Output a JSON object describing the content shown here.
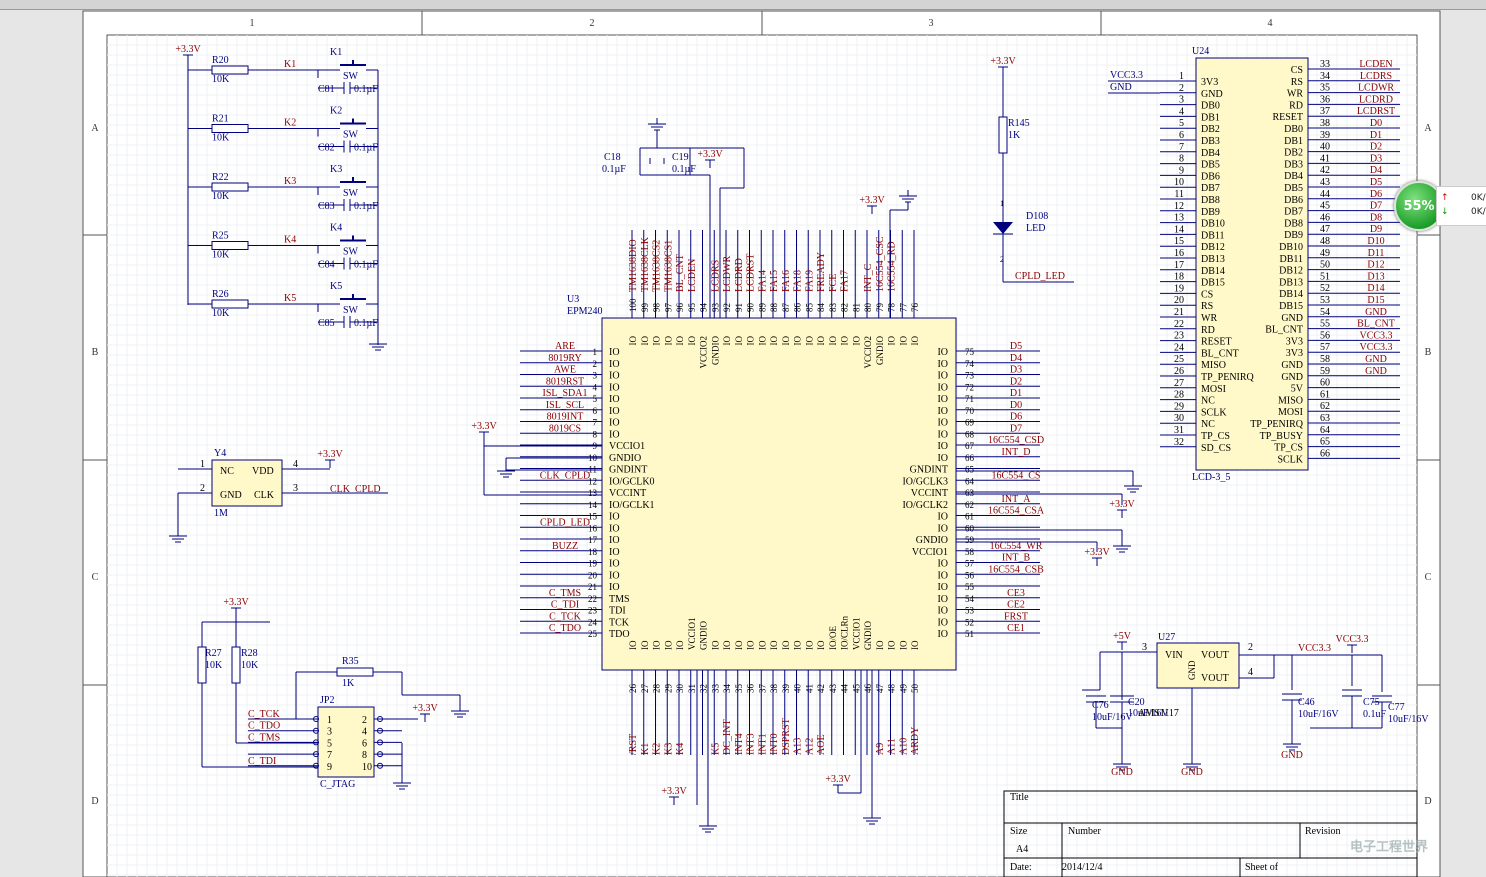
{
  "sheet": {
    "cols": [
      "1",
      "2",
      "3",
      "4"
    ],
    "rows": [
      "A",
      "B",
      "C",
      "D"
    ],
    "title_block": {
      "title_label": "Title",
      "size_label": "Size",
      "size_value": "A4",
      "number_label": "Number",
      "revision_label": "Revision",
      "date_label": "Date:",
      "date_value": "2014/12/4",
      "sheet_label": "Sheet    of"
    }
  },
  "power": {
    "v33": "+3.3V",
    "vcc33": "VCC3.3",
    "v5": "+5V",
    "gnd": "GND"
  },
  "keys": [
    {
      "r": "R20",
      "k": "K1",
      "sw": "K1",
      "c": "C81"
    },
    {
      "r": "R21",
      "k": "K2",
      "sw": "K2",
      "c": "C82"
    },
    {
      "r": "R22",
      "k": "K3",
      "sw": "K3",
      "c": "C83"
    },
    {
      "r": "R25",
      "k": "K4",
      "sw": "K4",
      "c": "C84"
    },
    {
      "r": "R26",
      "k": "K5",
      "sw": "K5",
      "c": "C85"
    }
  ],
  "key_common": {
    "rval": "10K",
    "sw": "SW",
    "cval": "0.1µF"
  },
  "osc": {
    "ref": "Y4",
    "val": "1M",
    "p1": "NC",
    "p2": "GND",
    "p3": "CLK",
    "p4": "VDD",
    "n1": "1",
    "n2": "2",
    "n3": "3",
    "n4": "4",
    "net": "CLK_CPLD"
  },
  "caps_top": {
    "c18": "C18",
    "c19": "C19",
    "val": "0.1µF"
  },
  "led": {
    "r": "R145",
    "rval": "1K",
    "d": "D108",
    "dval": "LED",
    "net": "CPLD_LED",
    "p1": "1",
    "p2": "2"
  },
  "jtag": {
    "ref": "JP2",
    "val": "C_JTAG",
    "r27": "R27",
    "r28": "R28",
    "rval": "10K",
    "r35": "R35",
    "r35v": "1K",
    "left_nums": [
      "1",
      "3",
      "5",
      "7",
      "9"
    ],
    "right_nums": [
      "2",
      "4",
      "6",
      "8",
      "10"
    ],
    "nets": [
      "C_TCK",
      "C_TDO",
      "C_TMS",
      "",
      "C_TDI"
    ]
  },
  "cpld": {
    "ref": "U3",
    "val": "EPM240",
    "left": [
      {
        "n": "1",
        "p": "IO",
        "net": "ARE"
      },
      {
        "n": "2",
        "p": "IO",
        "net": "8019RY"
      },
      {
        "n": "3",
        "p": "IO",
        "net": "AWE"
      },
      {
        "n": "4",
        "p": "IO",
        "net": "8019RST"
      },
      {
        "n": "5",
        "p": "IO",
        "net": "ISL_SDA1"
      },
      {
        "n": "6",
        "p": "IO",
        "net": "ISL_SCL"
      },
      {
        "n": "7",
        "p": "IO",
        "net": "8019INT"
      },
      {
        "n": "8",
        "p": "IO",
        "net": "8019CS"
      },
      {
        "n": "9",
        "p": "VCCIO1",
        "net": ""
      },
      {
        "n": "10",
        "p": "GNDIO",
        "net": ""
      },
      {
        "n": "11",
        "p": "GNDINT",
        "net": ""
      },
      {
        "n": "12",
        "p": "IO/GCLK0",
        "net": "CLK_CPLD"
      },
      {
        "n": "13",
        "p": "VCCINT",
        "net": ""
      },
      {
        "n": "14",
        "p": "IO/GCLK1",
        "net": ""
      },
      {
        "n": "15",
        "p": "IO",
        "net": ""
      },
      {
        "n": "16",
        "p": "IO",
        "net": "CPLD_LED"
      },
      {
        "n": "17",
        "p": "IO",
        "net": ""
      },
      {
        "n": "18",
        "p": "IO",
        "net": "BUZZ"
      },
      {
        "n": "19",
        "p": "IO",
        "net": ""
      },
      {
        "n": "20",
        "p": "IO",
        "net": ""
      },
      {
        "n": "21",
        "p": "IO",
        "net": ""
      },
      {
        "n": "22",
        "p": "TMS",
        "net": "C_TMS"
      },
      {
        "n": "23",
        "p": "TDI",
        "net": "C_TDI"
      },
      {
        "n": "24",
        "p": "TCK",
        "net": "C_TCK"
      },
      {
        "n": "25",
        "p": "TDO",
        "net": "C_TDO"
      }
    ],
    "right": [
      {
        "n": "75",
        "p": "IO",
        "net": "D5"
      },
      {
        "n": "74",
        "p": "IO",
        "net": "D4"
      },
      {
        "n": "73",
        "p": "IO",
        "net": "D3"
      },
      {
        "n": "72",
        "p": "IO",
        "net": "D2"
      },
      {
        "n": "71",
        "p": "IO",
        "net": "D1"
      },
      {
        "n": "70",
        "p": "IO",
        "net": "D0"
      },
      {
        "n": "69",
        "p": "IO",
        "net": "D6"
      },
      {
        "n": "68",
        "p": "IO",
        "net": "D7"
      },
      {
        "n": "67",
        "p": "IO",
        "net": "16C554_CSD"
      },
      {
        "n": "66",
        "p": "IO",
        "net": "INT_D"
      },
      {
        "n": "65",
        "p": "GNDINT",
        "net": ""
      },
      {
        "n": "64",
        "p": "IO/GCLK3",
        "net": "16C554_CS"
      },
      {
        "n": "63",
        "p": "VCCINT",
        "net": ""
      },
      {
        "n": "62",
        "p": "IO/GCLK2",
        "net": "INT_A"
      },
      {
        "n": "61",
        "p": "IO",
        "net": "16C554_CSA"
      },
      {
        "n": "60",
        "p": "IO",
        "net": ""
      },
      {
        "n": "59",
        "p": "GNDIO",
        "net": ""
      },
      {
        "n": "58",
        "p": "VCCIO1",
        "net": "16C554_WR"
      },
      {
        "n": "57",
        "p": "IO",
        "net": "INT_B"
      },
      {
        "n": "56",
        "p": "IO",
        "net": "16C554_CSB"
      },
      {
        "n": "55",
        "p": "IO",
        "net": ""
      },
      {
        "n": "54",
        "p": "IO",
        "net": "CE3"
      },
      {
        "n": "53",
        "p": "IO",
        "net": "CE2"
      },
      {
        "n": "52",
        "p": "IO",
        "net": "FRST"
      },
      {
        "n": "51",
        "p": "IO",
        "net": "CE1"
      }
    ],
    "top": [
      {
        "n": "100",
        "p": "IO",
        "net": "TM1638DIO"
      },
      {
        "n": "99",
        "p": "IO",
        "net": "TM1638CLK"
      },
      {
        "n": "98",
        "p": "IO",
        "net": "TM1638CS2"
      },
      {
        "n": "97",
        "p": "IO",
        "net": "TM1638CS1"
      },
      {
        "n": "96",
        "p": "IO",
        "net": "BL_CNT"
      },
      {
        "n": "95",
        "p": "IO",
        "net": "LCDEN"
      },
      {
        "n": "94",
        "p": "VCCIO2",
        "net": ""
      },
      {
        "n": "93",
        "p": "GNDIO",
        "net": "LCDRS"
      },
      {
        "n": "92",
        "p": "IO",
        "net": "LCDWR"
      },
      {
        "n": "91",
        "p": "IO",
        "net": "LCDRD"
      },
      {
        "n": "90",
        "p": "IO",
        "net": "LCDRST"
      },
      {
        "n": "89",
        "p": "IO",
        "net": "FA14"
      },
      {
        "n": "88",
        "p": "IO",
        "net": "FA15"
      },
      {
        "n": "87",
        "p": "IO",
        "net": "FA16"
      },
      {
        "n": "86",
        "p": "IO",
        "net": "FA18"
      },
      {
        "n": "85",
        "p": "IO",
        "net": "FA19"
      },
      {
        "n": "84",
        "p": "IO",
        "net": "FREADY"
      },
      {
        "n": "83",
        "p": "IO",
        "net": "FCE"
      },
      {
        "n": "82",
        "p": "IO",
        "net": "FA17"
      },
      {
        "n": "81",
        "p": "IO",
        "net": ""
      },
      {
        "n": "80",
        "p": "VCCIO2",
        "net": "INT_C"
      },
      {
        "n": "79",
        "p": "GNDIO",
        "net": "16C554_CSC"
      },
      {
        "n": "78",
        "p": "IO",
        "net": "16C554_RD"
      },
      {
        "n": "77",
        "p": "IO",
        "net": ""
      },
      {
        "n": "76",
        "p": "IO",
        "net": ""
      }
    ],
    "bottom": [
      {
        "n": "26",
        "p": "IO",
        "net": "/RST"
      },
      {
        "n": "27",
        "p": "IO",
        "net": "K1"
      },
      {
        "n": "28",
        "p": "IO",
        "net": "K2"
      },
      {
        "n": "29",
        "p": "IO",
        "net": "K3"
      },
      {
        "n": "30",
        "p": "IO",
        "net": "K4"
      },
      {
        "n": "31",
        "p": "VCCIO1",
        "net": ""
      },
      {
        "n": "32",
        "p": "GNDIO",
        "net": ""
      },
      {
        "n": "33",
        "p": "IO",
        "net": "K5"
      },
      {
        "n": "34",
        "p": "IO",
        "net": "DC_INT"
      },
      {
        "n": "35",
        "p": "IO",
        "net": "INT4"
      },
      {
        "n": "36",
        "p": "IO",
        "net": "INT3"
      },
      {
        "n": "37",
        "p": "IO",
        "net": "INT1"
      },
      {
        "n": "38",
        "p": "IO",
        "net": "INT0"
      },
      {
        "n": "39",
        "p": "IO",
        "net": "DSPRST"
      },
      {
        "n": "40",
        "p": "IO",
        "net": "A13"
      },
      {
        "n": "41",
        "p": "IO",
        "net": "A12"
      },
      {
        "n": "42",
        "p": "IO",
        "net": "AOE"
      },
      {
        "n": "43",
        "p": "IO/OE",
        "net": ""
      },
      {
        "n": "44",
        "p": "IO/CLRn",
        "net": ""
      },
      {
        "n": "45",
        "p": "VCCIO1",
        "net": ""
      },
      {
        "n": "46",
        "p": "GNDIO",
        "net": ""
      },
      {
        "n": "47",
        "p": "IO",
        "net": "A9"
      },
      {
        "n": "48",
        "p": "IO",
        "net": "A11"
      },
      {
        "n": "49",
        "p": "IO",
        "net": "A10"
      },
      {
        "n": "50",
        "p": "IO",
        "net": "ARDY"
      }
    ]
  },
  "lcd": {
    "ref": "U24",
    "val": "LCD-3_5",
    "left_nets": [
      "VCC3.3",
      "GND"
    ],
    "left": [
      "3V3",
      "GND",
      "DB0",
      "DB1",
      "DB2",
      "DB3",
      "DB4",
      "DB5",
      "DB6",
      "DB7",
      "DB8",
      "DB9",
      "DB10",
      "DB11",
      "DB12",
      "DB13",
      "DB14",
      "DB15",
      "CS",
      "RS",
      "WR",
      "RD",
      "RESET",
      "BL_CNT",
      "MISO",
      "TP_PENIRQ",
      "MOSI",
      "NC",
      "SCLK",
      "NC",
      "TP_CS",
      "SD_CS"
    ],
    "right_nums": [
      "33",
      "34",
      "35",
      "36",
      "37",
      "38",
      "39",
      "40",
      "41",
      "42",
      "43",
      "44",
      "45",
      "46",
      "47",
      "48",
      "49",
      "50",
      "51",
      "52",
      "53",
      "54",
      "55",
      "56",
      "57",
      "58",
      "59",
      "60",
      "61",
      "62",
      "63",
      "64",
      "65",
      "66"
    ],
    "right": [
      "CS",
      "RS",
      "WR",
      "RD",
      "RESET",
      "DB0",
      "DB1",
      "DB2",
      "DB3",
      "DB4",
      "DB5",
      "DB6",
      "DB7",
      "DB8",
      "DB9",
      "DB10",
      "DB11",
      "DB12",
      "DB13",
      "DB14",
      "DB15",
      "GND",
      "BL_CNT",
      "3V3",
      "3V3",
      "GND",
      "GND",
      "5V",
      "MISO",
      "MOSI",
      "TP_PENIRQ",
      "TP_BUSY",
      "TP_CS",
      "SCLK"
    ],
    "right_nets": [
      "LCDEN",
      "LCDRS",
      "LCDWR",
      "LCDRD",
      "LCDRST",
      "D0",
      "D1",
      "D2",
      "D3",
      "D4",
      "D5",
      "D6",
      "D7",
      "D8",
      "D9",
      "D10",
      "D11",
      "D12",
      "D13",
      "D14",
      "D15",
      "GND",
      "BL_CNT",
      "VCC3.3",
      "VCC3.3",
      "GND",
      "GND",
      "",
      "",
      "",
      "",
      "",
      "",
      ""
    ]
  },
  "reg": {
    "ref": "U27",
    "val": "AMS1117",
    "vin": "VIN",
    "vout": "VOUT",
    "gnd": "GND",
    "p1": "1",
    "p2": "2",
    "p3": "3",
    "p4": "4",
    "c76": "C76",
    "c20": "C20",
    "c46": "C46",
    "c75": "C75",
    "c77": "C77",
    "v10u": "10uF/16V",
    "v01": "0.1uF"
  },
  "overlay": {
    "gauge": "55%",
    "up": "0K/",
    "down": "0K/",
    "watermark": "电子工程世界"
  }
}
